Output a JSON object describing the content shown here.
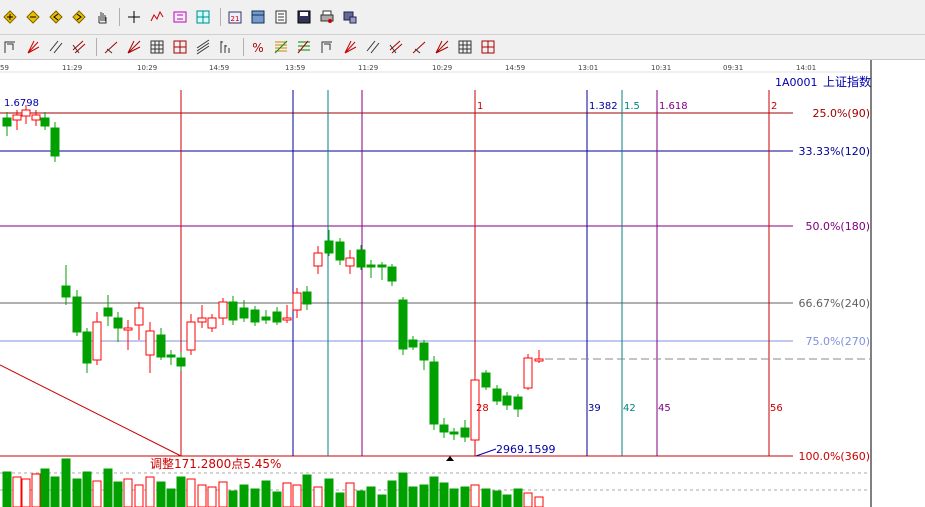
{
  "toolbar1": {
    "icons": [
      "zoom-in-icon",
      "zoom-out-icon",
      "move-left-icon",
      "move-right-icon",
      "hand-pan-icon",
      "crosshair-icon",
      "pattern-icon",
      "formula-icon",
      "tile-icon",
      "calendar-icon",
      "grid-window-icon",
      "list-icon",
      "save-icon",
      "print-icon",
      "data-transfer-icon"
    ]
  },
  "toolbar2": {
    "icons": [
      "line-tool-icon",
      "fan-line-icon",
      "parallel-line-icon",
      "channel-icon",
      "trend-line-icon",
      "speed-line-icon",
      "table-icon",
      "grid-icon",
      "angle-line-icon",
      "bar-chart-icon",
      "percent-tool-icon",
      "fibonacci-icon",
      "gann-icon",
      "arrow-icon",
      "cycle-icon",
      "period-icon",
      "retrace-icon",
      "box-icon",
      "box2-icon",
      "box3-icon",
      "box4-icon"
    ]
  },
  "time_axis": [
    "59",
    "11:29",
    "10:29",
    "14:59",
    "13:59",
    "11:29",
    "10:29",
    "14:59",
    "13:01",
    "10:31",
    "09:31",
    "14:01"
  ],
  "chart": {
    "code": "1A0001",
    "name": "上证指数",
    "top_price": "1.6798",
    "low_label": "2969.1599",
    "adjust_label": "调整171.2800点5.45%",
    "bg_color": "#ffffff",
    "up_color": "#ff0000",
    "down_color": "#00a000"
  },
  "chart_data": {
    "type": "candlestick",
    "levels": [
      {
        "label": "25.0%(90)",
        "color": "#a00000"
      },
      {
        "label": "33.33%(120)",
        "color": "#000099"
      },
      {
        "label": "50.0%(180)",
        "color": "#800080"
      },
      {
        "label": "66.67%(240)",
        "color": "#606060"
      },
      {
        "label": "75.0%(270)",
        "color": "#8090e0"
      },
      {
        "label": "100.0%(360)",
        "color": "#cc0000"
      }
    ],
    "fib_time_labels_top": [
      "1",
      "1.382",
      "1.5",
      "1.618",
      "2"
    ],
    "fib_time_labels_bottom": [
      "28",
      "39",
      "42",
      "45",
      "56"
    ]
  }
}
